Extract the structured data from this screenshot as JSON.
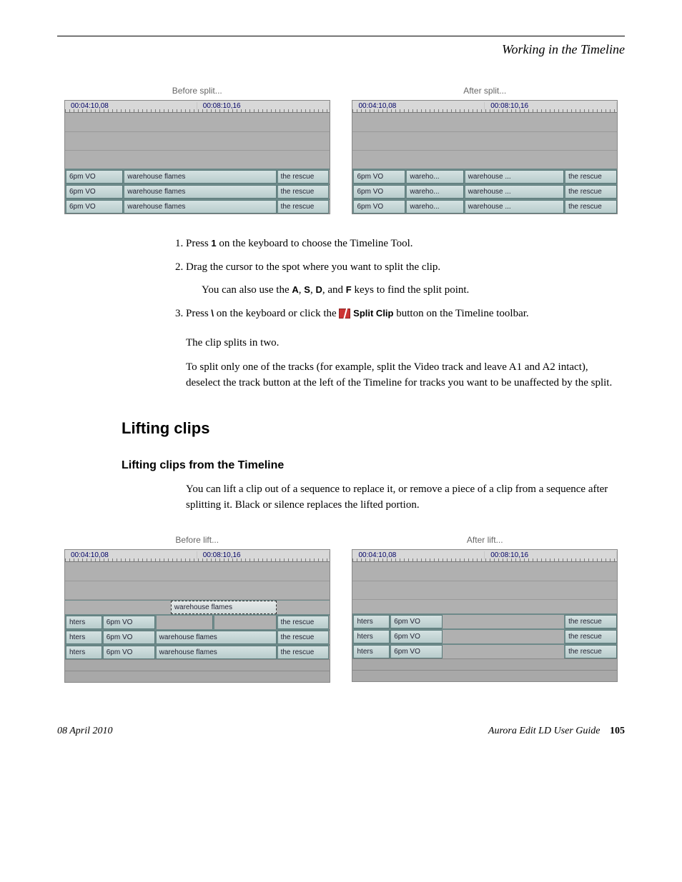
{
  "header": {
    "section_title": "Working in the Timeline"
  },
  "split_figure": {
    "before": {
      "caption": "Before split...",
      "tc": [
        "00:04:10,08",
        "00:08:10,16"
      ],
      "rows": [
        [
          "6pm VO",
          "warehouse flames",
          "the rescue"
        ],
        [
          "6pm VO",
          "warehouse flames",
          "the rescue"
        ],
        [
          "6pm VO",
          "warehouse flames",
          "the rescue"
        ]
      ]
    },
    "after": {
      "caption": "After split...",
      "tc": [
        "00:04:10,08",
        "00:08:10,16"
      ],
      "rows": [
        [
          "6pm VO",
          "wareho...",
          "warehouse ...",
          "the rescue"
        ],
        [
          "6pm VO",
          "wareho...",
          "warehouse ...",
          "the rescue"
        ],
        [
          "6pm VO",
          "wareho...",
          "warehouse ...",
          "the rescue"
        ]
      ]
    }
  },
  "steps": {
    "s1_a": "Press ",
    "s1_key": "1",
    "s1_b": " on the keyboard to choose the Timeline Tool.",
    "s2": "Drag the cursor to the spot where you want to split the clip.",
    "s2_note_a": "You can also use the ",
    "key_a": "A",
    "key_s": "S",
    "key_d": "D",
    "key_f": "F",
    "s2_note_b": " keys to find the split point.",
    "s3_a": "Press ",
    "s3_key": "\\",
    "s3_b": " on the keyboard or click the ",
    "s3_btn": "Split Clip",
    "s3_c": " button on the Timeline toolbar."
  },
  "paragraphs": {
    "p1": "The clip splits in two.",
    "p2": "To split only one of the tracks (for example, split the Video track and leave A1 and A2 intact), deselect the track button at the left of the Timeline for tracks you want to be unaffected by the split."
  },
  "lifting": {
    "heading": "Lifting clips",
    "subheading": "Lifting clips from the Timeline",
    "intro": "You can lift a clip out of a sequence to replace it, or remove a piece of a clip from a sequence after splitting it. Black or silence replaces the lifted portion."
  },
  "lift_figure": {
    "before": {
      "caption": "Before lift...",
      "tc": [
        "00:04:10,08",
        "00:08:10,16"
      ],
      "video_selected": "warehouse flames",
      "rows": [
        [
          "hters",
          "6pm VO",
          "",
          "",
          "the rescue"
        ],
        [
          "hters",
          "6pm VO",
          "warehouse flames",
          "the rescue"
        ],
        [
          "hters",
          "6pm VO",
          "warehouse flames",
          "the rescue"
        ]
      ]
    },
    "after": {
      "caption": "After lift...",
      "tc": [
        "00:04:10,08",
        "00:08:10,16"
      ],
      "rows": [
        [
          "hters",
          "6pm VO",
          "",
          "the rescue"
        ],
        [
          "hters",
          "6pm VO",
          "",
          "the rescue"
        ],
        [
          "hters",
          "6pm VO",
          "",
          "the rescue"
        ]
      ]
    }
  },
  "footer": {
    "date": "08 April 2010",
    "doc": "Aurora Edit LD User Guide",
    "page": "105"
  },
  "sep": {
    "comma": ", ",
    "and": ", and "
  }
}
